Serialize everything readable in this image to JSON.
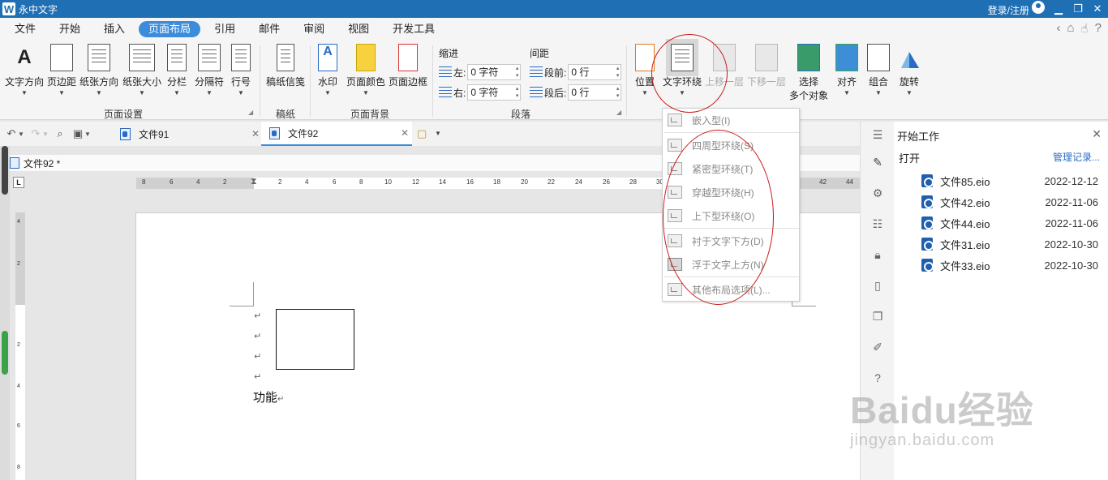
{
  "app": {
    "title": "永中文字",
    "login": "登录/注册"
  },
  "menu": {
    "tabs": [
      "文件",
      "开始",
      "插入",
      "页面布局",
      "引用",
      "邮件",
      "审阅",
      "视图",
      "开发工具"
    ],
    "active_index": 3
  },
  "ribbon": {
    "page_setup": {
      "buttons": [
        "文字方向",
        "页边距",
        "纸张方向",
        "纸张大小",
        "分栏",
        "分隔符",
        "行号"
      ],
      "label": "页面设置"
    },
    "manuscript": {
      "buttons": [
        "稿纸信笺"
      ],
      "label": "稿纸"
    },
    "background": {
      "buttons": [
        "水印",
        "页面颜色",
        "页面边框"
      ],
      "label": "页面背景"
    },
    "paragraph": {
      "indent_title": "缩进",
      "spacing_title": "间距",
      "left_label": "左:",
      "left_value": "0 字符",
      "right_label": "右:",
      "right_value": "0 字符",
      "before_label": "段前:",
      "before_value": "0 行",
      "after_label": "段后:",
      "after_value": "0 行",
      "label": "段落"
    },
    "arrange": {
      "position": "位置",
      "wrap": "文字环绕",
      "bring_forward": "上移一层",
      "send_backward": "下移一层",
      "select_line1": "选择",
      "select_line2": "多个对象",
      "align": "对齐",
      "group": "组合",
      "rotate": "旋转"
    }
  },
  "doc_tabs": [
    {
      "name": "文件91",
      "active": false
    },
    {
      "name": "文件92",
      "active": true
    }
  ],
  "doc_name": "文件92 *",
  "ruler": {
    "h_ticks": [
      "8",
      "6",
      "4",
      "2",
      "2",
      "4",
      "6",
      "8",
      "10",
      "12",
      "14",
      "16",
      "18",
      "20",
      "22",
      "24",
      "26",
      "28",
      "30",
      "42",
      "44"
    ],
    "v_ticks": [
      "4",
      "2",
      "2",
      "4",
      "6",
      "8"
    ]
  },
  "page": {
    "para_mark": "↵",
    "text": "功能"
  },
  "wrap_menu": {
    "items": [
      "嵌入型(I)",
      "四周型环绕(S)",
      "紧密型环绕(T)",
      "穿越型环绕(H)",
      "上下型环绕(O)",
      "衬于文字下方(D)",
      "浮于文字上方(N)",
      "其他布局选项(L)..."
    ]
  },
  "panel": {
    "title": "开始工作",
    "open": "打开",
    "manage": "管理记录...",
    "files": [
      {
        "name": "文件85.eio",
        "date": "2022-12-12"
      },
      {
        "name": "文件42.eio",
        "date": "2022-11-06"
      },
      {
        "name": "文件44.eio",
        "date": "2022-11-06"
      },
      {
        "name": "文件31.eio",
        "date": "2022-10-30"
      },
      {
        "name": "文件33.eio",
        "date": "2022-10-30"
      }
    ]
  },
  "watermark": {
    "line1": "Baidu经验",
    "line2": "jingyan.baidu.com"
  },
  "colors": {
    "title_bar": "#1f6fb5",
    "active_tab": "#3b8ddb",
    "annotation": "#c91a1a"
  }
}
